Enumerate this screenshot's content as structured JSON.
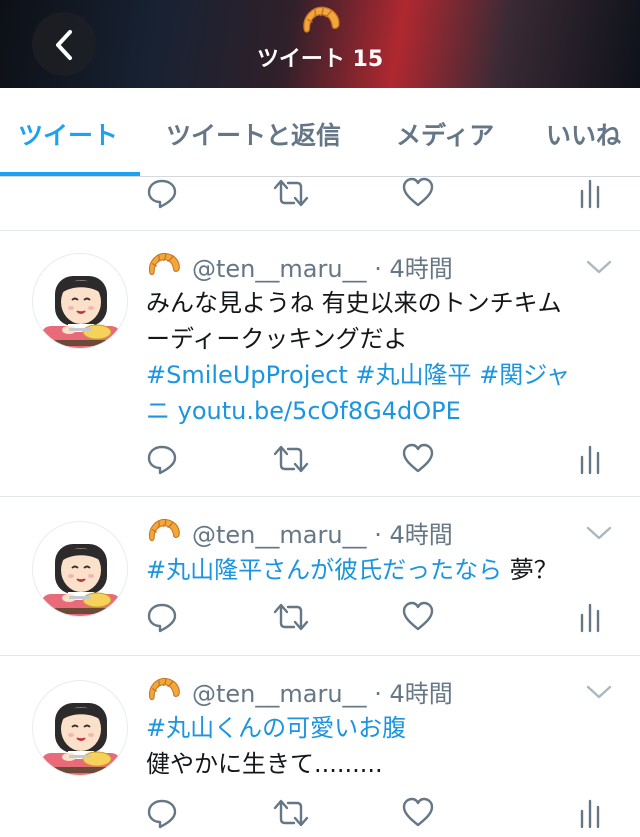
{
  "header": {
    "back_icon": "chevron-left-icon",
    "profile_emoji": "croissant-icon",
    "title": "ツイート 15"
  },
  "tabs": [
    {
      "label": "ツイート",
      "active": true
    },
    {
      "label": "ツイートと返信",
      "active": false
    },
    {
      "label": "メディア",
      "active": false
    },
    {
      "label": "いいね",
      "active": false
    }
  ],
  "action_icons": [
    "reply-icon",
    "retweet-icon",
    "like-icon",
    "analytics-icon"
  ],
  "tweets": [
    {
      "handle": "@ten__maru__",
      "sep": "·",
      "time": "4時間",
      "lines": [
        [
          {
            "text": "みんな見ようね 有史以来のトンチキム",
            "link": false
          }
        ],
        [
          {
            "text": "ーディークッキングだよ",
            "link": false
          }
        ],
        [
          {
            "text": "#SmileUpProject #丸山隆平 #関ジャ",
            "link": true
          }
        ],
        [
          {
            "text": "ニ youtu.be/5cOf8G4dOPE",
            "link": true
          }
        ]
      ]
    },
    {
      "handle": "@ten__maru__",
      "sep": "·",
      "time": "4時間",
      "lines": [
        [
          {
            "text": "#丸山隆平さんが彼氏だったなら",
            "link": true
          },
          {
            "text": " 夢？",
            "link": false
          }
        ]
      ]
    },
    {
      "handle": "@ten__maru__",
      "sep": "·",
      "time": "4時間",
      "lines": [
        [
          {
            "text": "#丸山くんの可愛いお腹",
            "link": true
          }
        ],
        [
          {
            "text": "健やかに生きて.........",
            "link": false
          }
        ]
      ]
    }
  ],
  "colors": {
    "accent": "#1da1f2",
    "link": "#1b95e0",
    "secondary_text": "#657786"
  }
}
